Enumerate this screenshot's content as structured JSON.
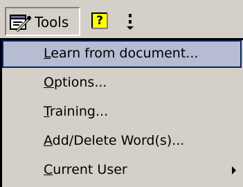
{
  "toolbar": {
    "tools_label": "Tools",
    "help_label": "?"
  },
  "menu": {
    "items": [
      {
        "accel": "L",
        "rest": "earn from document...",
        "highlighted": true,
        "submenu": false
      },
      {
        "accel": "O",
        "rest": "ptions...",
        "highlighted": false,
        "submenu": false
      },
      {
        "accel": "T",
        "rest": "raining...",
        "highlighted": false,
        "submenu": false
      },
      {
        "accel": "A",
        "rest": "dd/Delete Word(s)...",
        "highlighted": false,
        "submenu": false
      },
      {
        "accel": "C",
        "rest": "urrent User",
        "highlighted": false,
        "submenu": true
      }
    ]
  },
  "colors": {
    "face": "#d4d0c8",
    "highlight_fill": "#b6bdd2",
    "highlight_border": "#0a246a",
    "help_icon": "#ffff00"
  },
  "icons": [
    "tools-icon",
    "help-icon",
    "toolbar-options-icon",
    "submenu-arrow-icon"
  ]
}
